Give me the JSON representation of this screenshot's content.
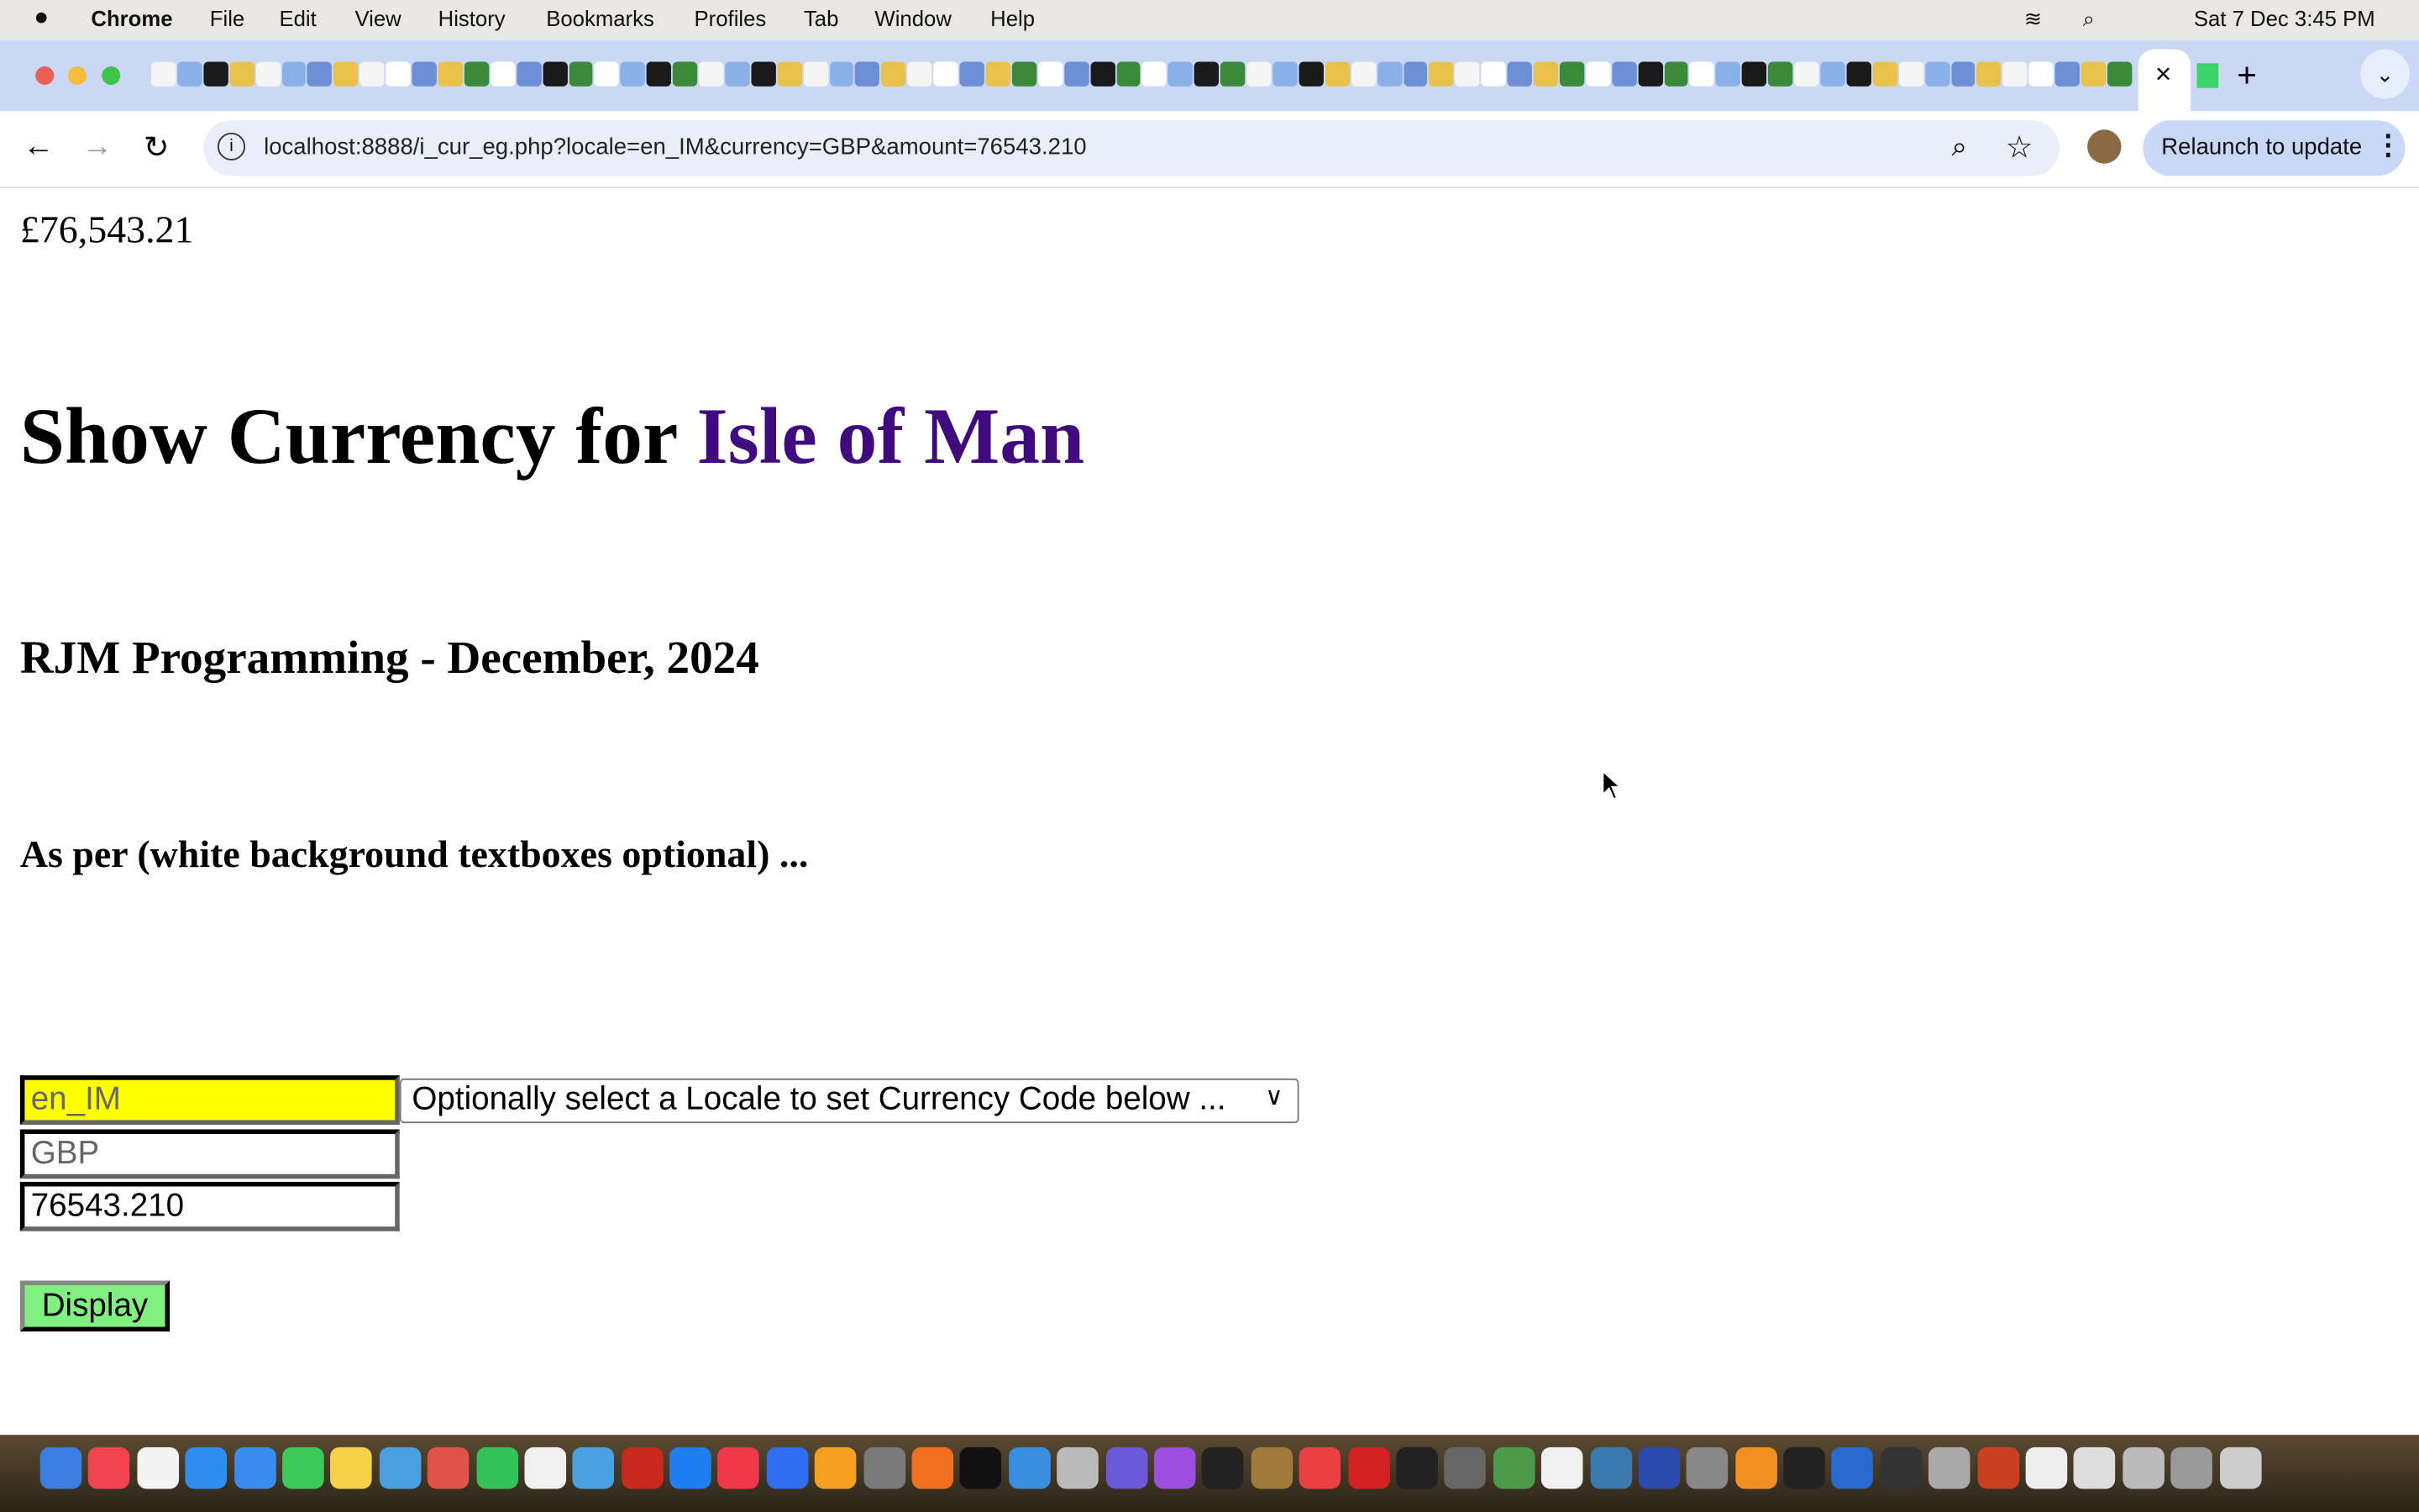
{
  "menubar": {
    "app": "Chrome",
    "items": [
      "File",
      "Edit",
      "View",
      "History",
      "Bookmarks",
      "Profiles",
      "Tab",
      "Window",
      "Help"
    ],
    "clock": "Sat 7 Dec  3:45 PM"
  },
  "browser": {
    "url": "localhost:8888/i_cur_eg.php?locale=en_IM&currency=GBP&amount=76543.210",
    "relaunch_label": "Relaunch to update",
    "tab_close": "×",
    "new_tab": "+"
  },
  "page": {
    "formatted_amount": "£76,543.21",
    "title_prefix": "Show Currency for ",
    "title_country": "Isle of Man",
    "subtitle": "RJM Programming - December, 2024",
    "note": "As per (white background textboxes optional) ...",
    "locale_value": "en_IM",
    "currency_value": "GBP",
    "amount_value": "76543.210",
    "locale_select": "Optionally select a Locale to set Currency Code below ...",
    "display_button": "Display"
  },
  "colors": {
    "country": "#3f0a7e",
    "locale_bg": "#ffff00",
    "button_bg": "#80f080",
    "tabstrip": "#cad8f6"
  }
}
